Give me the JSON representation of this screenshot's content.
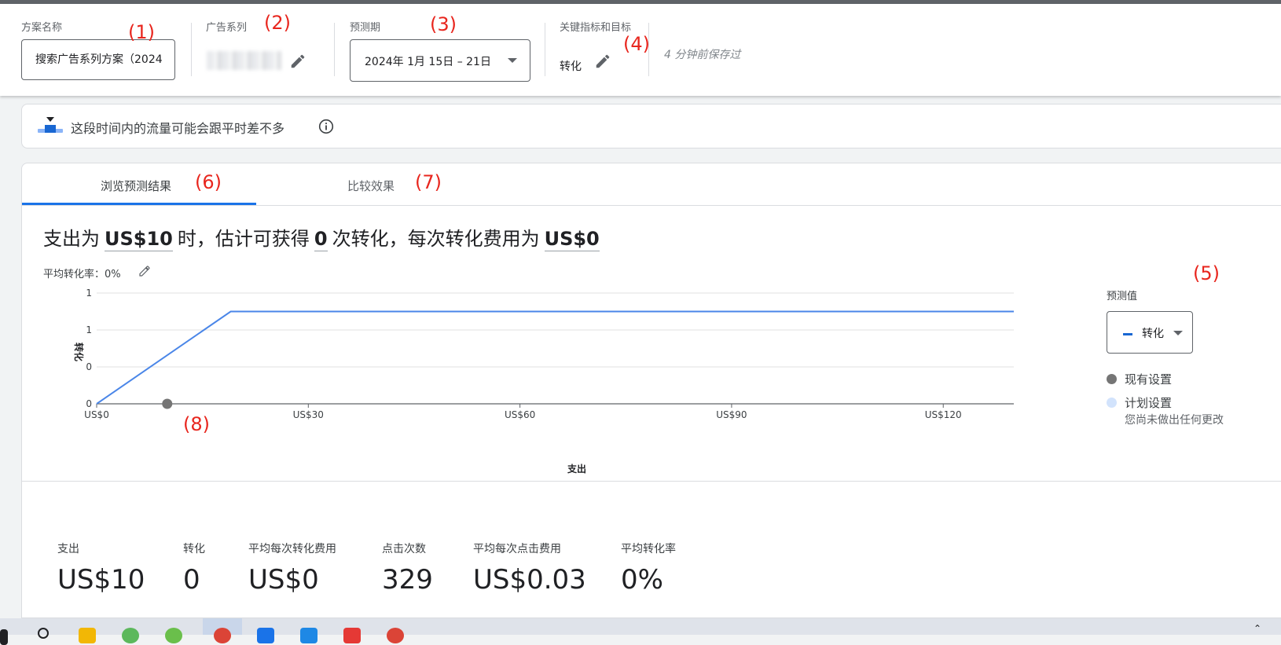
{
  "header": {
    "plan_name_label": "方案名称",
    "plan_name_value": "搜索广告系列方案（2024",
    "campaign_label": "广告系列",
    "forecast_period_label": "预测期",
    "forecast_period_value": "2024年 1月 15日 – 21日",
    "kpi_label": "关键指标和目标",
    "kpi_value": "转化",
    "saved_status": "4 分钟前保存过"
  },
  "notice": {
    "text": "这段时间内的流量可能会跟平时差不多"
  },
  "tabs": [
    {
      "label": "浏览预测结果",
      "active": true
    },
    {
      "label": "比较效果",
      "active": false
    }
  ],
  "summary": {
    "part1": "支出为",
    "spend": "US$10",
    "part2": "时，估计可获得",
    "conversions": "0",
    "part3": "次转化，每次转化费用为",
    "cpa": "US$0"
  },
  "avg_conversion_rate": "平均转化率：0%",
  "chart_data": {
    "type": "line",
    "xlabel": "支出",
    "ylabel": "转化",
    "x_ticks": [
      "US$0",
      "US$30",
      "US$60",
      "US$90",
      "US$120"
    ],
    "y_ticks": [
      "0",
      "0",
      "1",
      "1"
    ],
    "xlim": [
      0,
      130
    ],
    "ylim": [
      0,
      1.5
    ],
    "series": [
      {
        "name": "转化",
        "color": "#4a86e8",
        "x": [
          0,
          19,
          130
        ],
        "y": [
          0,
          1.25,
          1.25
        ]
      }
    ],
    "current_point": {
      "x": 10,
      "y": 0
    },
    "grid": true
  },
  "legend": {
    "label": "预测值",
    "metric_value": "转化",
    "current_settings": "现有设置",
    "planned_settings": "计划设置",
    "no_changes": "您尚未做出任何更改"
  },
  "stats": [
    {
      "label": "支出",
      "value": "US$10"
    },
    {
      "label": "转化",
      "value": "0"
    },
    {
      "label": "平均每次转化费用",
      "value": "US$0"
    },
    {
      "label": "点击次数",
      "value": "329"
    },
    {
      "label": "平均每次点击费用",
      "value": "US$0.03"
    },
    {
      "label": "平均转化率",
      "value": "0%"
    }
  ],
  "annotations": [
    "(1)",
    "(2)",
    "(3)",
    "(4)",
    "(5)",
    "(6)",
    "(7)",
    "(8)"
  ],
  "colors": {
    "accent": "#1a73e8",
    "series_line": "#4a86e8",
    "annotation_red": "#e8261e",
    "current_dot": "#757575",
    "planned_dot": "#d2e3fc"
  }
}
